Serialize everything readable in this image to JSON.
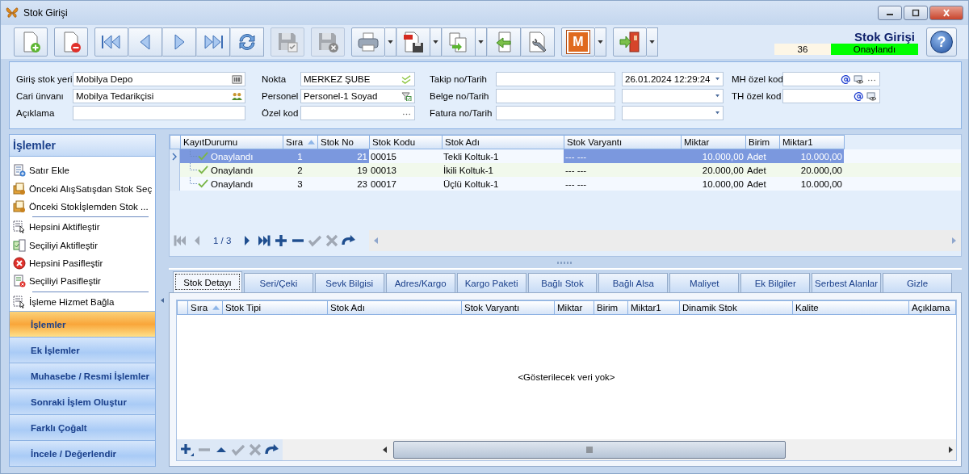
{
  "window": {
    "title": "Stok Girişi"
  },
  "toolbar": [
    {
      "kind": "new",
      "disabled": false,
      "dropdown": false,
      "gap_before": true
    },
    {
      "kind": "delete",
      "disabled": false,
      "dropdown": false,
      "gap_before": true
    },
    {
      "kind": "first",
      "disabled": false,
      "dropdown": false,
      "gap_before": true
    },
    {
      "kind": "prev",
      "disabled": false,
      "dropdown": false,
      "gap_before": false
    },
    {
      "kind": "next",
      "disabled": false,
      "dropdown": false,
      "gap_before": false
    },
    {
      "kind": "last",
      "disabled": false,
      "dropdown": false,
      "gap_before": false
    },
    {
      "kind": "refresh",
      "disabled": false,
      "dropdown": false,
      "gap_before": false
    },
    {
      "kind": "save-check",
      "disabled": true,
      "dropdown": false,
      "gap_before": true
    },
    {
      "kind": "save-x",
      "disabled": true,
      "dropdown": false,
      "gap_before": true
    },
    {
      "kind": "print",
      "disabled": false,
      "dropdown": true,
      "gap_before": true
    },
    {
      "kind": "pdf",
      "disabled": false,
      "dropdown": true,
      "gap_before": false
    },
    {
      "kind": "copy",
      "disabled": false,
      "dropdown": true,
      "gap_before": false
    },
    {
      "kind": "import",
      "disabled": false,
      "dropdown": false,
      "gap_before": false
    },
    {
      "kind": "settings",
      "disabled": false,
      "dropdown": false,
      "gap_before": false
    },
    {
      "kind": "logo",
      "label": "M",
      "disabled": false,
      "dropdown": true,
      "gap_before": true
    },
    {
      "kind": "exit",
      "disabled": false,
      "dropdown": true,
      "gap_before": true
    }
  ],
  "header": {
    "title": "Stok Girişi",
    "number": "36",
    "status": "Onaylandı",
    "help": "?"
  },
  "form": [
    [
      {
        "label": "Giriş stok yeri",
        "value": "Mobilya Depo",
        "kind": "text",
        "icons": [
          {
            "kind": "barcode"
          }
        ]
      },
      {
        "label": "Cari ünvanı",
        "value": "Mobilya Tedarikçisi",
        "kind": "text",
        "icons": [
          {
            "kind": "people"
          }
        ]
      },
      {
        "label": "Açıklama",
        "kind": "text"
      }
    ],
    [
      {
        "label": "Nokta",
        "value": "MERKEZ ŞUBE",
        "kind": "text",
        "icons": [
          {
            "kind": "check"
          }
        ]
      },
      {
        "label": "Personel",
        "value": "Personel-1 Soyad",
        "kind": "text",
        "icons": [
          {
            "kind": "filter"
          }
        ]
      },
      {
        "label": "Özel kod",
        "kind": "text",
        "icons": [
          {
            "kind": "ellipsis"
          }
        ]
      }
    ],
    [
      {
        "label": "Takip no/Tarih",
        "kind": "text-date",
        "date": "26.01.2024 12:29:24"
      },
      {
        "label": "Belge no/Tarih",
        "kind": "text-date"
      },
      {
        "label": "Fatura no/Tarih",
        "kind": "text-date"
      }
    ],
    [
      {
        "label": "MH özel kod",
        "kind": "text",
        "icons": [
          {
            "kind": "at"
          },
          {
            "kind": "eye"
          },
          {
            "kind": "ellipsis"
          }
        ]
      },
      {
        "label": "TH özel kod",
        "kind": "text",
        "icons": [
          {
            "kind": "at"
          },
          {
            "kind": "eye"
          }
        ]
      }
    ]
  ],
  "sidebar": {
    "title": "İşlemler",
    "items": [
      {
        "label": "Satır Ekle",
        "kind": "add-row",
        "separator_after": false
      },
      {
        "label": "Önceki AlışSatışdan Stok Seç",
        "kind": "folder",
        "separator_after": false
      },
      {
        "label": "Önceki Stokİşlemden Stok ...",
        "kind": "folder",
        "separator_after": true
      },
      {
        "label": "Hepsini Aktifleştir",
        "kind": "select-all",
        "separator_after": false
      },
      {
        "label": "Seçiliyi Aktifleştir",
        "kind": "select-one",
        "separator_after": false
      },
      {
        "label": "Hepsini Pasifleştir",
        "kind": "remove-all",
        "separator_after": false
      },
      {
        "label": "Seçiliyi Pasifleştir",
        "kind": "remove-one",
        "separator_after": true
      },
      {
        "label": "İşleme Hizmet Bağla",
        "kind": "select-all",
        "separator_after": false
      }
    ],
    "sections": [
      {
        "label": "İşlemler",
        "selected": true
      },
      {
        "label": "Ek İşlemler",
        "selected": false
      },
      {
        "label": "Muhasebe / Resmi İşlemler",
        "selected": false
      },
      {
        "label": "Sonraki İşlem Oluştur",
        "selected": false
      },
      {
        "label": "Farklı Çoğalt",
        "selected": false
      },
      {
        "label": "İncele / Değerlendir",
        "selected": false
      }
    ]
  },
  "grid": {
    "columns": [
      {
        "label": "KayıtDurumu",
        "sorted": false
      },
      {
        "label": "Sıra",
        "sorted": true
      },
      {
        "label": "Stok No",
        "sorted": false
      },
      {
        "label": "Stok Kodu",
        "sorted": false
      },
      {
        "label": "Stok Adı",
        "sorted": false
      },
      {
        "label": "Stok Varyantı",
        "sorted": false
      },
      {
        "label": "Miktar",
        "sorted": false
      },
      {
        "label": "Birim",
        "sorted": false
      },
      {
        "label": "Miktar1",
        "sorted": false
      }
    ],
    "rows": [
      {
        "selected": true,
        "cells": [
          "Onaylandı",
          "1",
          "21",
          "00015",
          "Tekli Koltuk-1",
          "--- ---",
          "10.000,00",
          "Adet",
          "10.000,00"
        ]
      },
      {
        "selected": false,
        "cells": [
          "Onaylandı",
          "2",
          "19",
          "00013",
          "İkili Koltuk-1",
          "--- ---",
          "20.000,00",
          "Adet",
          "20.000,00"
        ]
      },
      {
        "selected": false,
        "cells": [
          "Onaylandı",
          "3",
          "23",
          "00017",
          "Üçlü Koltuk-1",
          "--- ---",
          "10.000,00",
          "Adet",
          "10.000,00"
        ]
      }
    ],
    "navigator": {
      "position": "1 / 3",
      "buttons": [
        {
          "kind": "first",
          "disabled": true
        },
        {
          "kind": "prev",
          "disabled": true
        },
        {
          "kind": "pos"
        },
        {
          "kind": "next",
          "disabled": false
        },
        {
          "kind": "last",
          "disabled": false
        },
        {
          "kind": "plus",
          "disabled": false
        },
        {
          "kind": "minus",
          "disabled": false
        },
        {
          "kind": "check",
          "disabled": true
        },
        {
          "kind": "x",
          "disabled": true
        },
        {
          "kind": "redo",
          "disabled": false
        }
      ]
    }
  },
  "tabs": [
    {
      "label": "Stok Detayı",
      "selected": true
    },
    {
      "label": "Seri/Çeki",
      "selected": false
    },
    {
      "label": "Sevk Bilgisi",
      "selected": false
    },
    {
      "label": "Adres/Kargo",
      "selected": false
    },
    {
      "label": "Kargo Paketi",
      "selected": false
    },
    {
      "label": "Bağlı Stok",
      "selected": false
    },
    {
      "label": "Bağlı Alsa",
      "selected": false
    },
    {
      "label": "Maliyet",
      "selected": false
    },
    {
      "label": "Ek Bilgiler",
      "selected": false
    },
    {
      "label": "Serbest Alanlar",
      "selected": false
    },
    {
      "label": "Gizle",
      "selected": false
    }
  ],
  "detail": {
    "columns": [
      {
        "label": "Sıra",
        "sorted": true
      },
      {
        "label": "Stok Tipi",
        "sorted": false
      },
      {
        "label": "Stok Adı",
        "sorted": false
      },
      {
        "label": "Stok Varyantı",
        "sorted": false
      },
      {
        "label": "Miktar",
        "sorted": false
      },
      {
        "label": "Birim",
        "sorted": false
      },
      {
        "label": "Miktar1",
        "sorted": false
      },
      {
        "label": "Dinamik Stok",
        "sorted": false
      },
      {
        "label": "Kalite",
        "sorted": false
      },
      {
        "label": "Açıklama",
        "sorted": false
      }
    ],
    "empty_text": "<Gösterilecek veri yok>",
    "navigator": [
      {
        "kind": "add",
        "disabled": false
      },
      {
        "kind": "minus",
        "disabled": true
      },
      {
        "kind": "up",
        "disabled": false
      },
      {
        "kind": "check",
        "disabled": true
      },
      {
        "kind": "x",
        "disabled": true
      },
      {
        "kind": "redo",
        "disabled": false
      }
    ]
  }
}
